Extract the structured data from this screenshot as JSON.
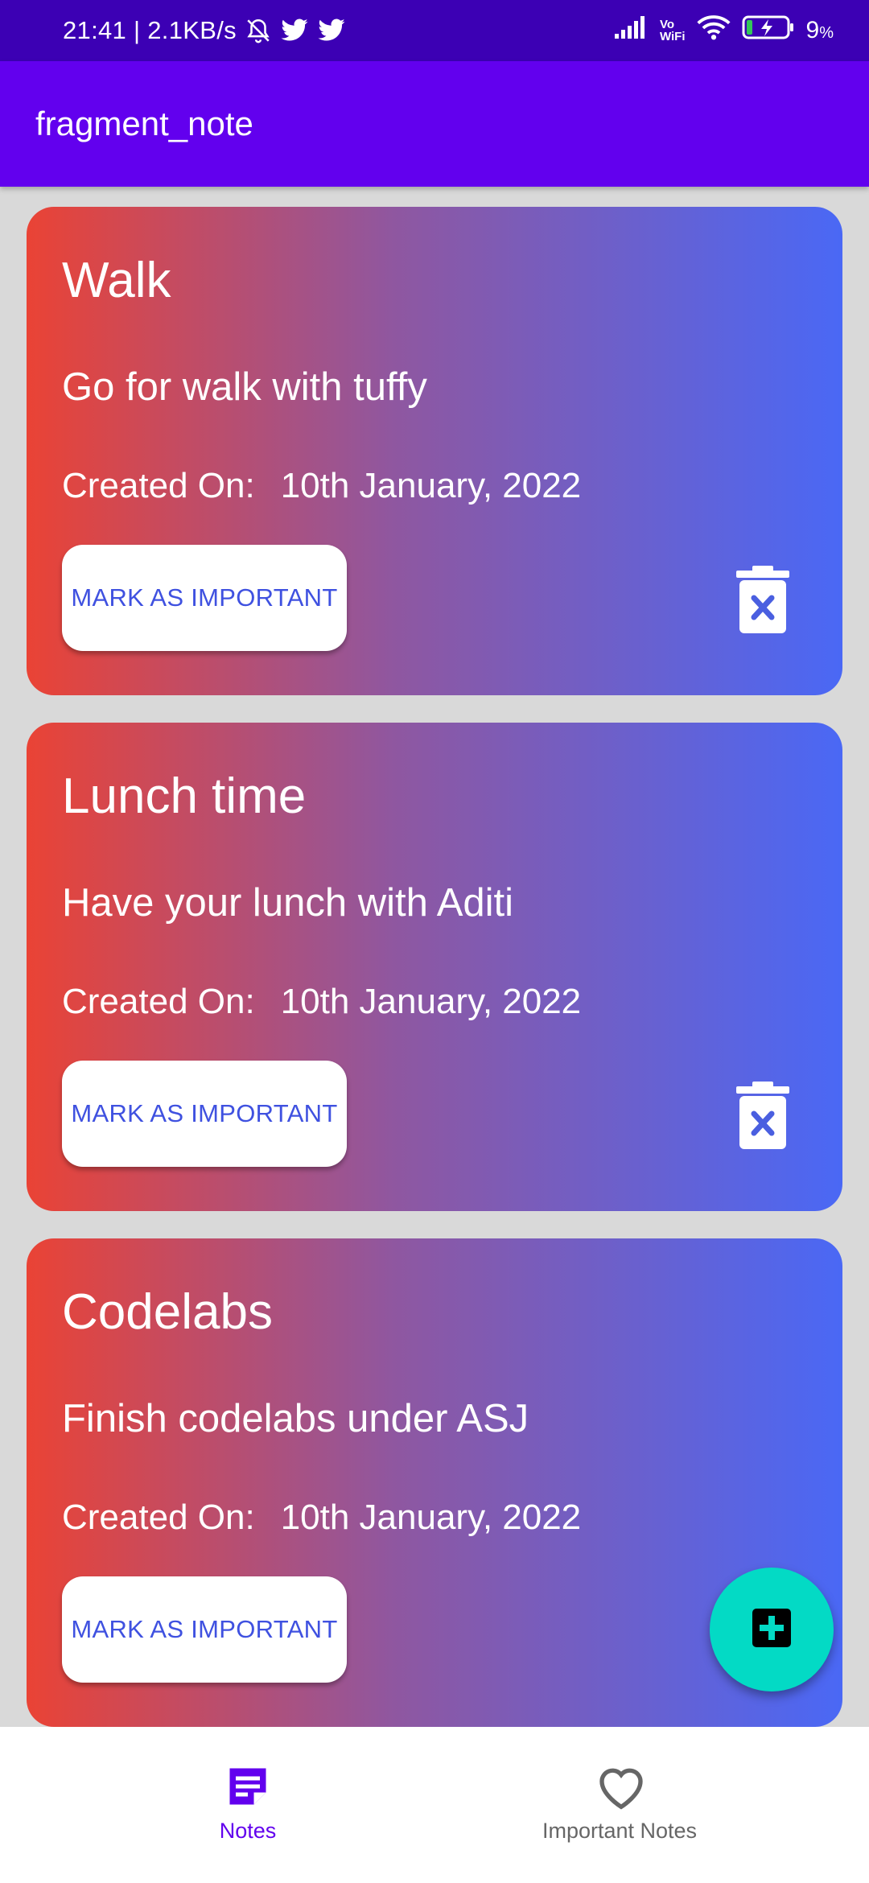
{
  "status_bar": {
    "time_speed": "21:41 | 2.1KB/s",
    "vo_label": "Vo",
    "wifi_label": "WiFi",
    "battery_pct": "9",
    "battery_unit": "%",
    "icons": [
      "bell-off-icon",
      "twitter-icon",
      "twitter-icon",
      "signal-icon",
      "wifi-icon",
      "battery-charging-icon"
    ]
  },
  "app_bar": {
    "title": "fragment_note"
  },
  "notes": [
    {
      "title": "Walk",
      "description": "Go for walk with tuffy",
      "created_label": "Created On:",
      "created_date": "10th January, 2022",
      "mark_label": "MARK AS IMPORTANT"
    },
    {
      "title": "Lunch time",
      "description": "Have your lunch with Aditi",
      "created_label": "Created On:",
      "created_date": "10th January, 2022",
      "mark_label": "MARK AS IMPORTANT"
    },
    {
      "title": "Codelabs",
      "description": "Finish codelabs under ASJ",
      "created_label": "Created On:",
      "created_date": "10th January, 2022",
      "mark_label": "MARK AS IMPORTANT"
    }
  ],
  "bottom_nav": {
    "notes_label": "Notes",
    "important_label": "Important Notes",
    "selected": "Notes"
  },
  "colors": {
    "status_bar": "#3c00b4",
    "app_bar": "#6200ee",
    "fab": "#03dac5",
    "card_gradient_start": "#ea4335",
    "card_gradient_end": "#4a68f5",
    "nav_selected": "#6200ee",
    "nav_unselected": "#666666",
    "button_text": "#3f51e0"
  }
}
